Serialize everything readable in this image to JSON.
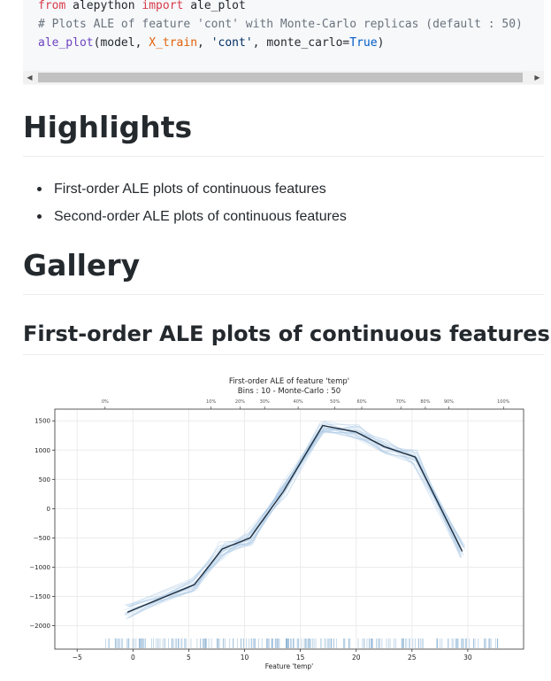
{
  "code": {
    "line1": {
      "t1": "from",
      "t2": " alepython ",
      "t3": "import",
      "t4": " ale_plot"
    },
    "line2": {
      "comment": "# Plots ALE of feature 'cont' with Monte-Carlo replicas (default : 50)"
    },
    "line3": {
      "fn": "ale_plot",
      "p1": "(model, ",
      "arg": "X_train",
      "p2": ", ",
      "str": "'cont'",
      "p3": ", monte_carlo=",
      "val": "True",
      "p4": ")"
    }
  },
  "scrollbar": {
    "left_arrow": "◀",
    "right_arrow": "▶"
  },
  "highlights": {
    "heading": "Highlights",
    "items": [
      "First-order ALE plots of continuous features",
      "Second-order ALE plots of continuous features"
    ]
  },
  "gallery": {
    "heading": "Gallery",
    "subheading": "First-order ALE plots of continuous features"
  },
  "chart_data": {
    "type": "line",
    "title": "First-order ALE of feature 'temp'",
    "subtitle": "Bins : 10 - Monte-Carlo : 50",
    "xlabel": "Feature 'temp'",
    "xlim": [
      -7,
      35
    ],
    "ylim": [
      -2400,
      1700
    ],
    "x_ticks": [
      -5,
      0,
      5,
      10,
      15,
      20,
      25,
      30
    ],
    "x_tick_labels": [
      "−5",
      "0",
      "5",
      "10",
      "15",
      "20",
      "25",
      "30"
    ],
    "y_ticks": [
      1500,
      1000,
      500,
      0,
      -500,
      -1000,
      -1500,
      -2000
    ],
    "y_tick_labels": [
      "1500",
      "1000",
      "500",
      "0",
      "−500",
      "−1000",
      "−1500",
      "−2000"
    ],
    "top_axis": {
      "labels": [
        "0%",
        "10%",
        "20%",
        "30%",
        "40%",
        "50%",
        "60%",
        "70%",
        "80%",
        "90%",
        "100%"
      ],
      "positions": [
        -2.5,
        7.0,
        9.6,
        11.8,
        14.8,
        18.1,
        20.5,
        24.0,
        26.2,
        28.3,
        33.2
      ]
    },
    "series": [
      {
        "x": [
          -0.5,
          5.5,
          8.0,
          10.5,
          13.5,
          17.0,
          20.0,
          22.5,
          25.3,
          29.5
        ],
        "y": [
          -1770,
          -1300,
          -690,
          -500,
          300,
          1420,
          1310,
          1060,
          880,
          -730
        ]
      }
    ],
    "colors": {
      "mean_line": "#1f2d3d",
      "replicas": "#a8c8e4",
      "rug": "#6c9ec8"
    },
    "grid": true
  }
}
